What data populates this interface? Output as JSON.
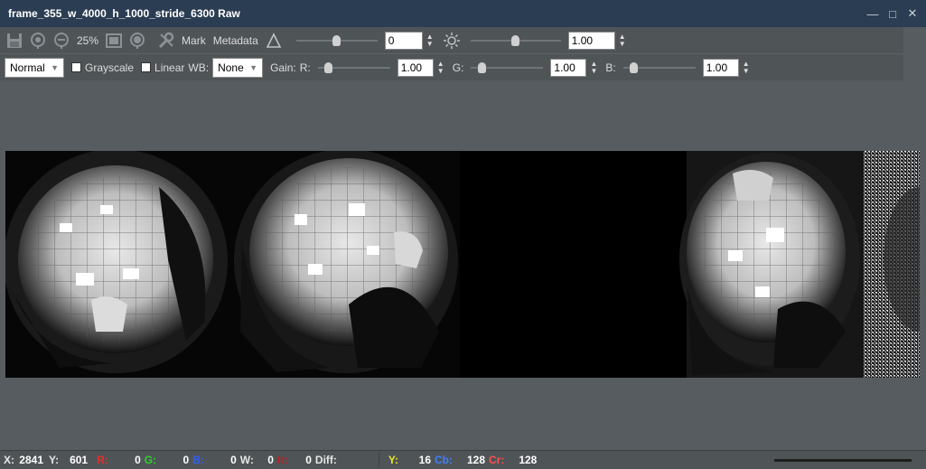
{
  "window": {
    "title": "frame_355_w_4000_h_1000_stride_6300 Raw",
    "minimize": "—",
    "maximize": "□",
    "close": "✕"
  },
  "toolbar": {
    "zoom": "25%",
    "mark_label": "Mark",
    "metadata_label": "Metadata",
    "contrast_value": "0",
    "contrast_level": 0.5,
    "brightness_value": "1.00",
    "brightness_level": 0.5
  },
  "toolbar2": {
    "mode_select": "Normal",
    "grayscale_label": "Grayscale",
    "linear_label": "Linear",
    "wb_label": "WB:",
    "wb_select": "None",
    "gain_label": "Gain:",
    "r_label": "R:",
    "r_value": "1.00",
    "g_label": "G:",
    "g_value": "1.00",
    "b_label": "B:",
    "b_value": "1.00",
    "r_level": 0.1,
    "g_level": 0.1,
    "b_level": 0.1
  },
  "status": {
    "x_label": "X:",
    "x_value": "2841",
    "y_label": "Y:",
    "y_value": "601",
    "r_label": "R:",
    "r_value": "0",
    "g_label": "G:",
    "g_value": "0",
    "b_label": "B:",
    "b_value": "0",
    "w_label": "W:",
    "w_value": "0",
    "ir_label": "Ir:",
    "ir_value": "0",
    "diff_label": "Diff:",
    "yy_label": "Y:",
    "yy_value": "16",
    "cb_label": "Cb:",
    "cb_value": "128",
    "cr_label": "Cr:",
    "cr_value": "128"
  },
  "colors": {
    "titlebar": "#2b3d52",
    "toolbar": "#4f5457",
    "canvas": "#565c60",
    "r": "#e03030",
    "g": "#30d030",
    "b": "#3060f0",
    "ir": "#c02020",
    "y": "#e8e820",
    "cb": "#4080ff",
    "cr": "#ff5050"
  }
}
